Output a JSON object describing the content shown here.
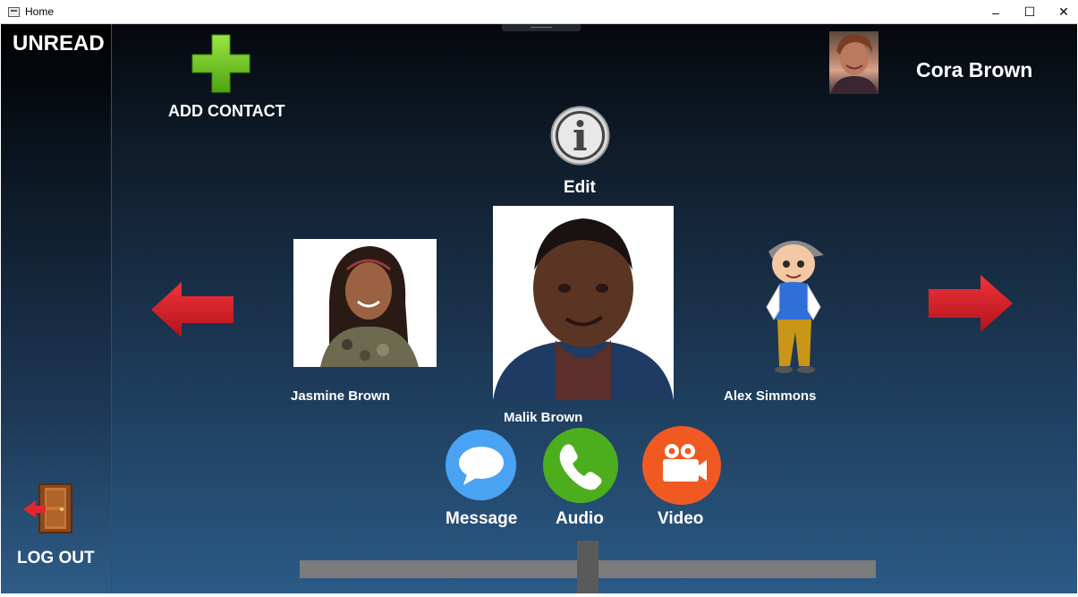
{
  "window": {
    "title": "Home",
    "controls": {
      "minimize": "–",
      "maximize": "☐",
      "close": "✕"
    }
  },
  "sidebar": {
    "unread_label": "UNREAD",
    "logout_label": "LOG OUT",
    "logout_icon": "door-exit-icon"
  },
  "toolbar": {
    "add_contact_label": "ADD CONTACT",
    "add_icon": "plus-icon"
  },
  "current_user": {
    "name": "Cora Brown"
  },
  "edit": {
    "label": "Edit",
    "icon": "info-icon"
  },
  "contacts": {
    "previous_icon": "arrow-left-icon",
    "next_icon": "arrow-right-icon",
    "left": {
      "name": "Jasmine Brown"
    },
    "center": {
      "name": "Malik Brown"
    },
    "right": {
      "name": "Alex Simmons"
    }
  },
  "actions": {
    "message": {
      "label": "Message",
      "icon": "chat-bubble-icon",
      "color": "#4aa3f2"
    },
    "audio": {
      "label": "Audio",
      "icon": "phone-icon",
      "color": "#4dae1d"
    },
    "video": {
      "label": "Video",
      "icon": "video-camera-icon",
      "color": "#f05a22"
    }
  },
  "slider": {
    "value": 0.5
  },
  "colors": {
    "arrow": "#d8202a",
    "plus": "#6ac41c"
  }
}
